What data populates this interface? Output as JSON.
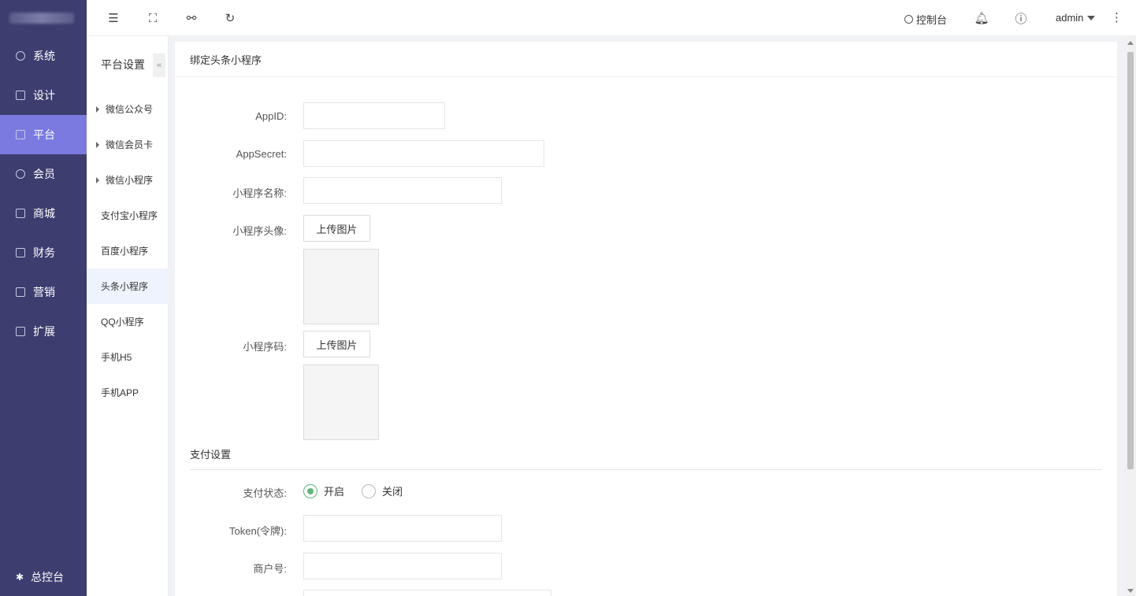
{
  "sidebar": {
    "items": [
      {
        "label": "系统",
        "icon": "gear-icon"
      },
      {
        "label": "设计",
        "icon": "monitor-icon"
      },
      {
        "label": "平台",
        "icon": "monitor-icon"
      },
      {
        "label": "会员",
        "icon": "user-icon"
      },
      {
        "label": "商城",
        "icon": "shop-icon"
      },
      {
        "label": "财务",
        "icon": "yen-icon"
      },
      {
        "label": "营销",
        "icon": "gift-icon"
      },
      {
        "label": "扩展",
        "icon": "grid-icon"
      }
    ],
    "active_item": "平台",
    "footer": "总控台"
  },
  "topbar": {
    "console": "控制台",
    "user": "admin"
  },
  "submenu": {
    "title": "平台设置",
    "items": [
      {
        "label": "微信公众号",
        "expandable": true
      },
      {
        "label": "微信会员卡",
        "expandable": true
      },
      {
        "label": "微信小程序",
        "expandable": true
      },
      {
        "label": "支付宝小程序",
        "expandable": false
      },
      {
        "label": "百度小程序",
        "expandable": false
      },
      {
        "label": "头条小程序",
        "expandable": false
      },
      {
        "label": "QQ小程序",
        "expandable": false
      },
      {
        "label": "手机H5",
        "expandable": false
      },
      {
        "label": "手机APP",
        "expandable": false
      }
    ],
    "active_item": "头条小程序"
  },
  "form": {
    "title": "绑定头条小程序",
    "appid_label": "AppID:",
    "appid_value": "",
    "appsecret_label": "AppSecret:",
    "appsecret_value": "",
    "name_label": "小程序名称:",
    "name_value": "",
    "avatar_label": "小程序头像:",
    "upload_label": "上传图片",
    "qrcode_label": "小程序码:",
    "pay_section": "支付设置",
    "pay_status_label": "支付状态:",
    "pay_on": "开启",
    "pay_off": "关闭",
    "pay_status_selected": "开启",
    "token_label": "Token(令牌):",
    "token_value": "",
    "merchant_label": "商户号:",
    "merchant_value": ""
  }
}
